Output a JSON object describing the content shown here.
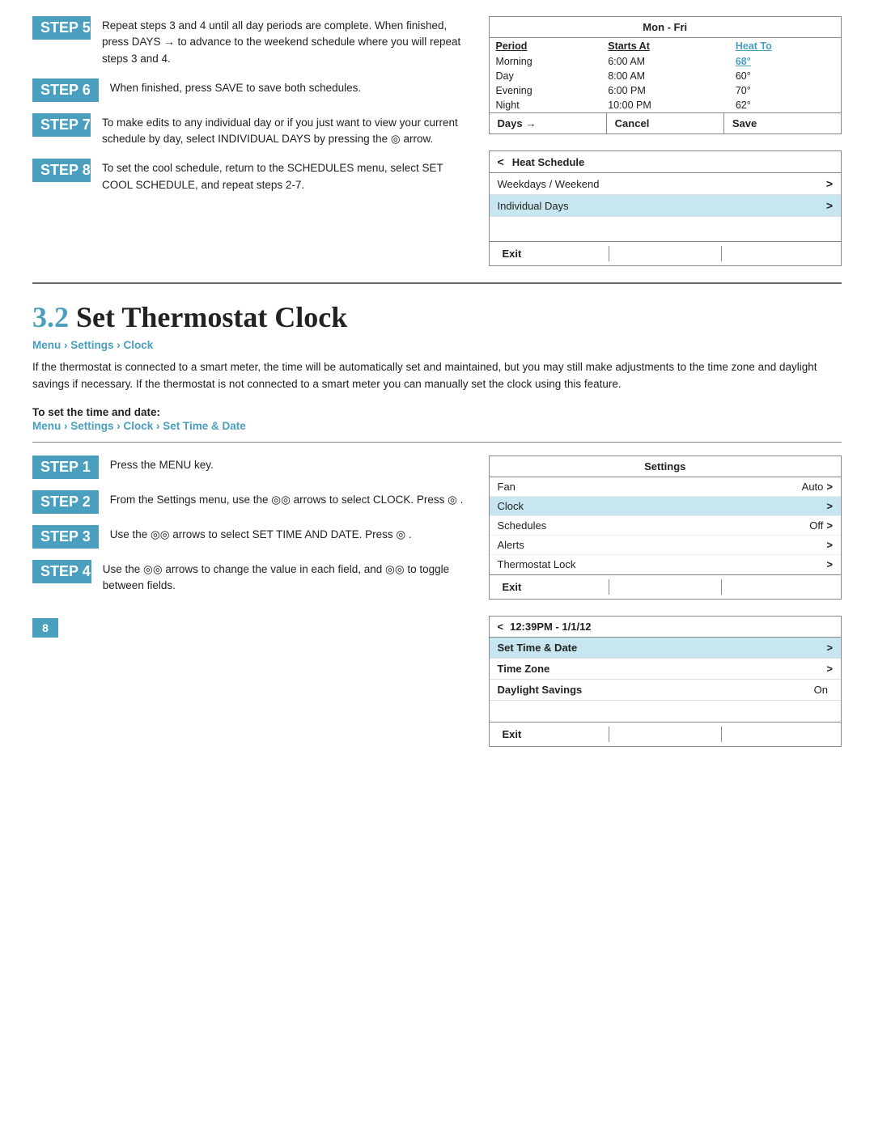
{
  "top": {
    "steps": [
      {
        "id": "STEP 5",
        "text": "Repeat steps 3 and 4 until all day periods are complete. When finished, press DAYS → to advance to the weekend schedule where you will repeat steps 3 and 4."
      },
      {
        "id": "STEP 6",
        "text": "When finished, press SAVE to save both schedules."
      },
      {
        "id": "STEP 7",
        "text": "To make edits to any individual day or if you just want to view your current schedule by day, select INDIVIDUAL DAYS by pressing the ⊙ arrow."
      },
      {
        "id": "STEP 8",
        "text": "To set the cool schedule, return to the SCHEDULES menu, select SET COOL SCHEDULE, and repeat steps 2-7."
      }
    ],
    "mon_fri_panel": {
      "title": "Mon - Fri",
      "columns": [
        "Period",
        "Starts At",
        "Heat To"
      ],
      "rows": [
        {
          "period": "Morning",
          "starts": "6:00 AM",
          "heat": "68°"
        },
        {
          "period": "Day",
          "starts": "8:00 AM",
          "heat": "60°"
        },
        {
          "period": "Evening",
          "starts": "6:00 PM",
          "heat": "70°"
        },
        {
          "period": "Night",
          "starts": "10:00 PM",
          "heat": "62°"
        }
      ],
      "footer": [
        "Days →",
        "Cancel",
        "Save"
      ]
    },
    "heat_schedule_panel": {
      "back": "<",
      "title": "Heat Schedule",
      "rows": [
        {
          "label": "Weekdays / Weekend",
          "highlighted": false,
          "arrow": ">"
        },
        {
          "label": "Individual Days",
          "highlighted": true,
          "arrow": ">"
        }
      ],
      "footer": [
        "Exit",
        "",
        ""
      ]
    }
  },
  "section": {
    "heading_num": "3.2",
    "heading_text": "Set Thermostat Clock",
    "breadcrumb": "Menu › Settings › Clock",
    "desc": "If the thermostat is connected to a smart meter, the time will be automatically set and maintained, but you may still make adjustments to the time zone and daylight savings if necessary. If the thermostat is not connected to a smart meter you can manually set the clock using this feature.",
    "sub_line1": "To set the time and date:",
    "sub_line2": "Menu › Settings › Clock › Set Time & Date"
  },
  "bottom": {
    "steps": [
      {
        "id": "STEP 1",
        "text": "Press the MENU key."
      },
      {
        "id": "STEP 2",
        "text": "From the Settings menu, use the ⊙⊙ arrows to select CLOCK. Press ⊙ ."
      },
      {
        "id": "STEP 3",
        "text": "Use the ⊙⊙ arrows to select SET TIME AND DATE. Press ⊙ ."
      },
      {
        "id": "STEP 4",
        "text": "Use the ⊙⊙ arrows to change the value in each field, and ⊙⊙ to toggle between fields."
      }
    ],
    "settings_panel": {
      "title": "Settings",
      "rows": [
        {
          "label": "Fan",
          "value": "Auto",
          "arrow": ">",
          "selected": false
        },
        {
          "label": "Clock",
          "value": "",
          "arrow": ">",
          "selected": true
        },
        {
          "label": "Schedules",
          "value": "Off",
          "arrow": ">",
          "selected": false
        },
        {
          "label": "Alerts",
          "value": "",
          "arrow": ">",
          "selected": false
        },
        {
          "label": "Thermostat Lock",
          "value": "",
          "arrow": ">",
          "selected": false
        }
      ],
      "footer": [
        "Exit",
        "",
        ""
      ]
    },
    "clock_panel": {
      "back": "<",
      "title": "12:39PM - 1/1/12",
      "rows": [
        {
          "label": "Set Time & Date",
          "value": "",
          "arrow": ">",
          "selected": true
        },
        {
          "label": "Time Zone",
          "value": "",
          "arrow": ">",
          "selected": false
        },
        {
          "label": "Daylight Savings",
          "value": "On",
          "arrow": "",
          "selected": false
        }
      ],
      "footer": [
        "Exit",
        "",
        ""
      ]
    }
  },
  "page_number": "8"
}
